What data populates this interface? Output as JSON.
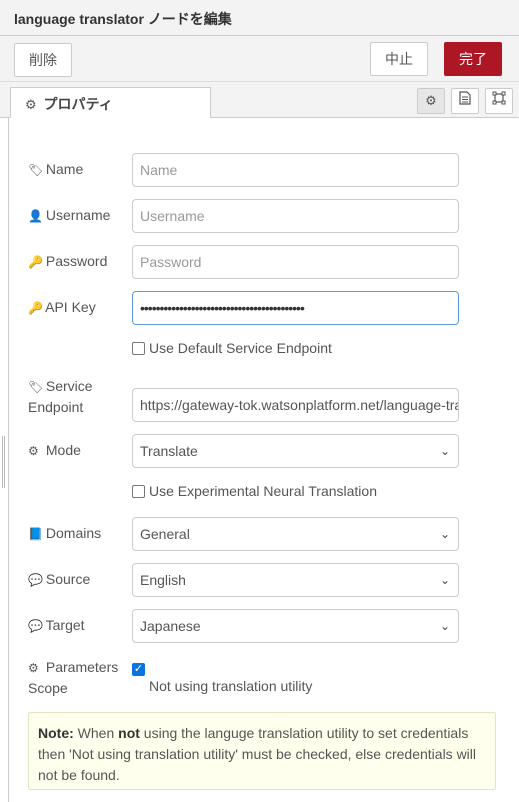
{
  "header": {
    "title": "language translator ノードを編集"
  },
  "toolbar": {
    "delete_label": "削除",
    "cancel_label": "中止",
    "done_label": "完了"
  },
  "tabs": {
    "properties_label": "プロパティ"
  },
  "fields": {
    "name": {
      "label": "Name",
      "placeholder": "Name"
    },
    "username": {
      "label": "Username",
      "placeholder": "Username"
    },
    "password": {
      "label": "Password",
      "placeholder": "Password"
    },
    "apikey": {
      "label": "API Key",
      "value": "••••••••••••••••••••••••••••••••••••••••••"
    },
    "default_endpoint": {
      "label": "Use Default Service Endpoint",
      "checked": false
    },
    "service_endpoint": {
      "label_line1": "Service",
      "label_line2": "Endpoint",
      "value": "https://gateway-tok.watsonplatform.net/language-translator/api"
    },
    "mode": {
      "label": "Mode",
      "value": "Translate"
    },
    "neural": {
      "label": "Use Experimental Neural Translation",
      "checked": false
    },
    "domains": {
      "label": "Domains",
      "value": "General"
    },
    "source": {
      "label": "Source",
      "value": "English"
    },
    "target": {
      "label": "Target",
      "value": "Japanese"
    },
    "scope": {
      "label_line1": "Parameters",
      "label_line2": "Scope",
      "checked": true,
      "text": "Not using translation utility"
    }
  },
  "note": {
    "prefix": "Note:",
    "part1": " When ",
    "bold": "not",
    "part2": " using the languge translation utility to set credentials then 'Not using translation utility' must be checked, else credentials will not be found."
  },
  "colors": {
    "accent": "#ad1625",
    "focus_border": "#5b9bd5",
    "checkbox": "#0b74de",
    "note_bg": "#ffffee"
  }
}
